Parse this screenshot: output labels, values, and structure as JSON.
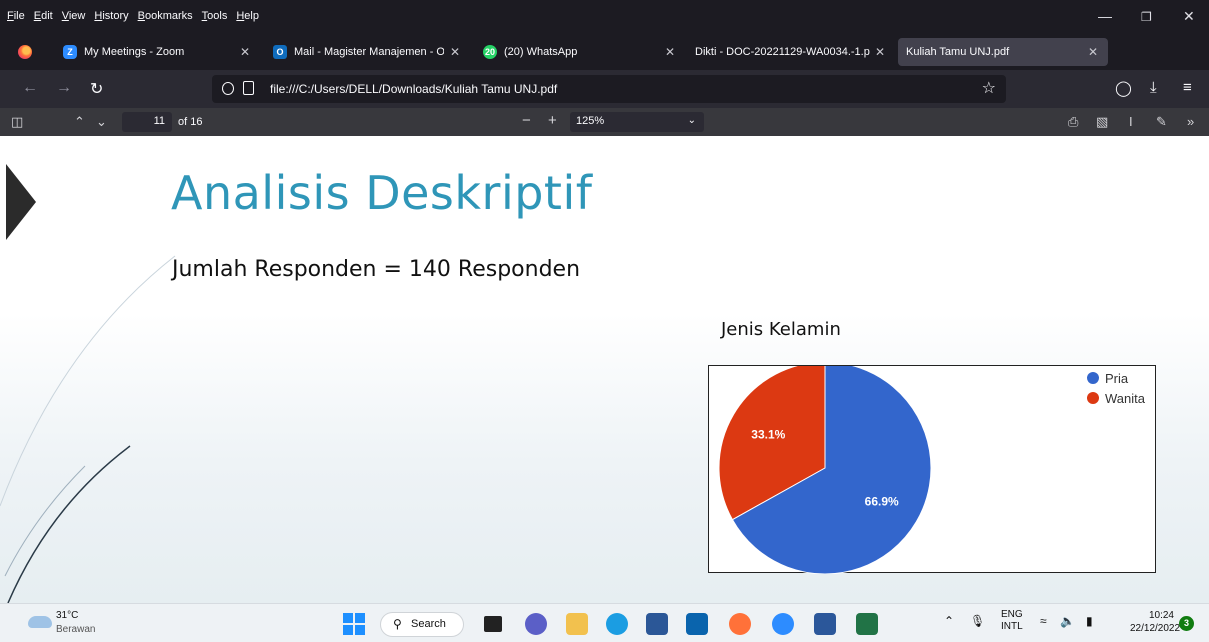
{
  "menu": [
    "File",
    "Edit",
    "View",
    "History",
    "Bookmarks",
    "Tools",
    "Help"
  ],
  "tabs": [
    {
      "title": "My Meetings - Zoom",
      "icon": "zoom-icon",
      "color": "#2d8cff"
    },
    {
      "title": "Mail - Magister Manajemen - O",
      "icon": "outlook-icon",
      "color": "#0f6cbd"
    },
    {
      "title": "(20) WhatsApp",
      "icon": "whatsapp-icon",
      "color": "#25d366",
      "badge": "20"
    },
    {
      "title": "Dikti - DOC-20221129-WA0034.-1.p",
      "icon": "document-icon",
      "color": "#888888"
    },
    {
      "title": "Kuliah Tamu UNJ.pdf",
      "icon": "pdf-icon",
      "color": "#42414d",
      "active": true
    }
  ],
  "url": "file:///C:/Users/DELL/Downloads/Kuliah Tamu UNJ.pdf",
  "pdf": {
    "page": "11",
    "page_of": "of 16",
    "zoom": "125%"
  },
  "slide": {
    "title": "Analisis Deskriptif",
    "subtitle": "Jumlah Responden = 140 Responden",
    "chart_heading": "Jenis Kelamin"
  },
  "chart_data": {
    "type": "pie",
    "title": "Jenis Kelamin",
    "categories": [
      "Pria",
      "Wanita"
    ],
    "values": [
      66.9,
      33.1
    ],
    "labels": [
      "66.9%",
      "33.1%"
    ],
    "colors": [
      "#3366cc",
      "#dc3912"
    ],
    "legend": "top-right"
  },
  "taskbar": {
    "temp": "31°C",
    "weather": "Berawan",
    "search": "Search",
    "lang_top": "ENG",
    "lang_bottom": "INTL",
    "time": "10:24",
    "date": "22/12/2022",
    "notifications": "3"
  }
}
